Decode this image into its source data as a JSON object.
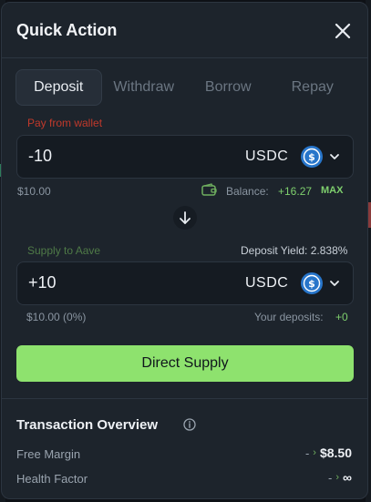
{
  "dialog": {
    "title": "Quick Action",
    "close_icon": "close-icon"
  },
  "tabs": [
    {
      "label": "Deposit",
      "active": true
    },
    {
      "label": "Withdraw",
      "active": false
    },
    {
      "label": "Borrow",
      "active": false
    },
    {
      "label": "Repay",
      "active": false
    }
  ],
  "pay": {
    "label": "Pay from wallet",
    "amount": "-10",
    "token": "USDC",
    "usd_value": "$10.00",
    "balance_label": "Balance:",
    "balance_value": "+16.27",
    "max_label": "MAX"
  },
  "supply": {
    "label": "Supply to Aave",
    "yield_text": "Deposit Yield: 2.838%",
    "amount": "+10",
    "token": "USDC",
    "usd_value": "$10.00 (0%)",
    "deposits_label": "Your deposits:",
    "deposits_value": "+0"
  },
  "action_button": "Direct Supply",
  "overview": {
    "title": "Transaction Overview",
    "rows": [
      {
        "label": "Free Margin",
        "from": "-",
        "to": "$8.50"
      },
      {
        "label": "Health Factor",
        "from": "-",
        "to": "∞"
      }
    ]
  },
  "colors": {
    "accent_green": "#8ee26e",
    "error_label": "#c0392b",
    "usdc_blue": "#2775ca"
  }
}
